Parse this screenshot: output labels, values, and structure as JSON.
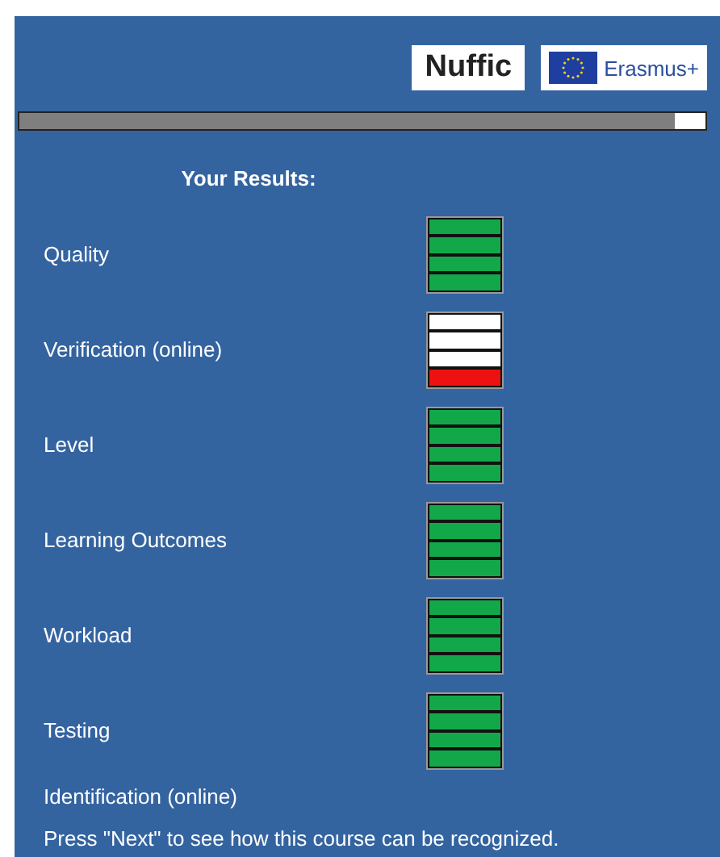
{
  "logos": {
    "nuffic": "Nuffic",
    "erasmus": "Erasmus+"
  },
  "progress": {
    "level": 0.955
  },
  "heading": "Your Results:",
  "results": [
    {
      "label": "Quality",
      "level": 1,
      "color": "#12a84a"
    },
    {
      "label": "Verification (online)",
      "level": 0.25,
      "color": "#ee1111"
    },
    {
      "label": "Level",
      "level": 1,
      "color": "#12a84a"
    },
    {
      "label": "Learning Outcomes",
      "level": 1,
      "color": "#12a84a"
    },
    {
      "label": "Workload",
      "level": 1,
      "color": "#12a84a"
    },
    {
      "label": "Testing",
      "level": 1,
      "color": "#12a84a"
    },
    {
      "label": "Identification (online)"
    }
  ],
  "footer": "Press \"Next\" to see how this course can be recognized."
}
